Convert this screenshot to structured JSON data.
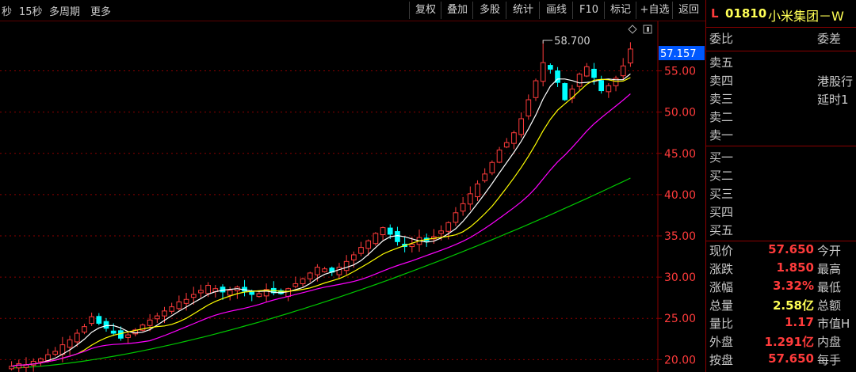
{
  "toolbar": {
    "left_items": [
      "秒",
      "15秒",
      "多周期",
      "更多"
    ],
    "buttons": [
      "复权",
      "叠加",
      "多股",
      "统计",
      "画线",
      "F10",
      "标记",
      "+自选",
      "返回"
    ]
  },
  "quote_panel": {
    "market_flag": "L",
    "code": "01810",
    "name": "小米集团－W",
    "header_left": "委比",
    "header_right": "委差",
    "sell_levels": [
      "卖五",
      "卖四",
      "卖三",
      "卖二",
      "卖一"
    ],
    "buy_levels": [
      "买一",
      "买二",
      "买三",
      "买四",
      "买五"
    ],
    "note_line1": "港股行",
    "note_line2": "延时1",
    "stats": [
      {
        "label": "现价",
        "value": "57.650",
        "label2": "今开",
        "color": "#ff3b3b"
      },
      {
        "label": "涨跌",
        "value": "1.850",
        "label2": "最高",
        "color": "#ff3b3b"
      },
      {
        "label": "涨幅",
        "value": "3.32%",
        "label2": "最低",
        "color": "#ff3b3b"
      },
      {
        "label": "总量",
        "value": "2.58亿",
        "label2": "总额",
        "color": "#ffff55"
      },
      {
        "label": "量比",
        "value": "1.17",
        "label2": "市值H",
        "color": "#ff3b3b"
      },
      {
        "label": "外盘",
        "value": "1.291亿",
        "label2": "内盘",
        "color": "#ff3b3b"
      },
      {
        "label": "按盘",
        "value": "57.650",
        "label2": "每手",
        "color": "#ff3b3b"
      }
    ]
  },
  "colors": {
    "up": "#ff3b3b",
    "down": "#00ffff",
    "ma5": "#ffffff",
    "ma10": "#ffff00",
    "ma20": "#ff00ff",
    "ma60": "#00c800",
    "grid": "#8a0000",
    "axis_text": "#ff3b3b",
    "current_price_box": "#0058ff"
  },
  "chart_data": {
    "type": "candlestick",
    "ylim": [
      18.5,
      61.0
    ],
    "y_ticks": [
      20.0,
      25.0,
      30.0,
      35.0,
      40.0,
      45.0,
      50.0,
      55.0
    ],
    "y_tick_labels": [
      "20.00",
      "25.00",
      "30.00",
      "35.00",
      "40.00",
      "45.00",
      "50.00",
      "55.00"
    ],
    "current_price_label": "57.157",
    "current_price": 57.157,
    "high_annotation": "58.700",
    "high_value": 58.7,
    "ma60_start": 19.0,
    "ma60_end": 42.0,
    "closes": [
      19.2,
      19.5,
      19.4,
      19.8,
      20.1,
      20.6,
      21.0,
      21.8,
      22.4,
      23.2,
      24.0,
      25.2,
      24.4,
      23.8,
      23.2,
      22.6,
      23.0,
      23.6,
      24.2,
      24.8,
      25.3,
      25.9,
      26.4,
      27.0,
      27.3,
      27.9,
      28.4,
      29.0,
      28.6,
      28.2,
      28.4,
      28.8,
      28.3,
      27.9,
      28.0,
      28.5,
      28.1,
      28.0,
      28.6,
      29.2,
      29.8,
      30.5,
      31.2,
      31.0,
      30.6,
      31.2,
      31.9,
      32.7,
      33.6,
      34.4,
      35.3,
      36.0,
      35.2,
      34.3,
      33.7,
      34.0,
      34.8,
      34.4,
      34.9,
      35.6,
      36.6,
      37.8,
      38.9,
      40.1,
      41.3,
      42.5,
      43.9,
      45.4,
      46.3,
      47.5,
      49.2,
      51.5,
      53.8,
      56.0,
      55.2,
      53.6,
      51.5,
      52.8,
      54.6,
      55.5,
      54.2,
      52.6,
      53.2,
      54.1,
      55.6,
      57.65
    ]
  }
}
